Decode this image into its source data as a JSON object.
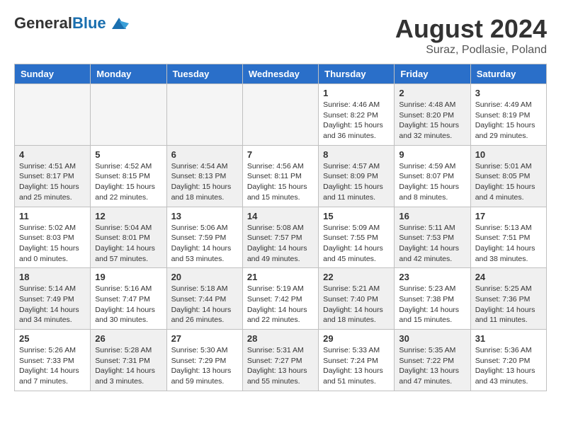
{
  "header": {
    "logo_general": "General",
    "logo_blue": "Blue",
    "month_year": "August 2024",
    "location": "Suraz, Podlasie, Poland"
  },
  "weekdays": [
    "Sunday",
    "Monday",
    "Tuesday",
    "Wednesday",
    "Thursday",
    "Friday",
    "Saturday"
  ],
  "weeks": [
    [
      {
        "day": "",
        "info": "",
        "empty": true
      },
      {
        "day": "",
        "info": "",
        "empty": true
      },
      {
        "day": "",
        "info": "",
        "empty": true
      },
      {
        "day": "",
        "info": "",
        "empty": true
      },
      {
        "day": "1",
        "info": "Sunrise: 4:46 AM\nSunset: 8:22 PM\nDaylight: 15 hours\nand 36 minutes.",
        "shaded": false
      },
      {
        "day": "2",
        "info": "Sunrise: 4:48 AM\nSunset: 8:20 PM\nDaylight: 15 hours\nand 32 minutes.",
        "shaded": true
      },
      {
        "day": "3",
        "info": "Sunrise: 4:49 AM\nSunset: 8:19 PM\nDaylight: 15 hours\nand 29 minutes.",
        "shaded": false
      }
    ],
    [
      {
        "day": "4",
        "info": "Sunrise: 4:51 AM\nSunset: 8:17 PM\nDaylight: 15 hours\nand 25 minutes.",
        "shaded": true
      },
      {
        "day": "5",
        "info": "Sunrise: 4:52 AM\nSunset: 8:15 PM\nDaylight: 15 hours\nand 22 minutes.",
        "shaded": false
      },
      {
        "day": "6",
        "info": "Sunrise: 4:54 AM\nSunset: 8:13 PM\nDaylight: 15 hours\nand 18 minutes.",
        "shaded": true
      },
      {
        "day": "7",
        "info": "Sunrise: 4:56 AM\nSunset: 8:11 PM\nDaylight: 15 hours\nand 15 minutes.",
        "shaded": false
      },
      {
        "day": "8",
        "info": "Sunrise: 4:57 AM\nSunset: 8:09 PM\nDaylight: 15 hours\nand 11 minutes.",
        "shaded": true
      },
      {
        "day": "9",
        "info": "Sunrise: 4:59 AM\nSunset: 8:07 PM\nDaylight: 15 hours\nand 8 minutes.",
        "shaded": false
      },
      {
        "day": "10",
        "info": "Sunrise: 5:01 AM\nSunset: 8:05 PM\nDaylight: 15 hours\nand 4 minutes.",
        "shaded": true
      }
    ],
    [
      {
        "day": "11",
        "info": "Sunrise: 5:02 AM\nSunset: 8:03 PM\nDaylight: 15 hours\nand 0 minutes.",
        "shaded": false
      },
      {
        "day": "12",
        "info": "Sunrise: 5:04 AM\nSunset: 8:01 PM\nDaylight: 14 hours\nand 57 minutes.",
        "shaded": true
      },
      {
        "day": "13",
        "info": "Sunrise: 5:06 AM\nSunset: 7:59 PM\nDaylight: 14 hours\nand 53 minutes.",
        "shaded": false
      },
      {
        "day": "14",
        "info": "Sunrise: 5:08 AM\nSunset: 7:57 PM\nDaylight: 14 hours\nand 49 minutes.",
        "shaded": true
      },
      {
        "day": "15",
        "info": "Sunrise: 5:09 AM\nSunset: 7:55 PM\nDaylight: 14 hours\nand 45 minutes.",
        "shaded": false
      },
      {
        "day": "16",
        "info": "Sunrise: 5:11 AM\nSunset: 7:53 PM\nDaylight: 14 hours\nand 42 minutes.",
        "shaded": true
      },
      {
        "day": "17",
        "info": "Sunrise: 5:13 AM\nSunset: 7:51 PM\nDaylight: 14 hours\nand 38 minutes.",
        "shaded": false
      }
    ],
    [
      {
        "day": "18",
        "info": "Sunrise: 5:14 AM\nSunset: 7:49 PM\nDaylight: 14 hours\nand 34 minutes.",
        "shaded": true
      },
      {
        "day": "19",
        "info": "Sunrise: 5:16 AM\nSunset: 7:47 PM\nDaylight: 14 hours\nand 30 minutes.",
        "shaded": false
      },
      {
        "day": "20",
        "info": "Sunrise: 5:18 AM\nSunset: 7:44 PM\nDaylight: 14 hours\nand 26 minutes.",
        "shaded": true
      },
      {
        "day": "21",
        "info": "Sunrise: 5:19 AM\nSunset: 7:42 PM\nDaylight: 14 hours\nand 22 minutes.",
        "shaded": false
      },
      {
        "day": "22",
        "info": "Sunrise: 5:21 AM\nSunset: 7:40 PM\nDaylight: 14 hours\nand 18 minutes.",
        "shaded": true
      },
      {
        "day": "23",
        "info": "Sunrise: 5:23 AM\nSunset: 7:38 PM\nDaylight: 14 hours\nand 15 minutes.",
        "shaded": false
      },
      {
        "day": "24",
        "info": "Sunrise: 5:25 AM\nSunset: 7:36 PM\nDaylight: 14 hours\nand 11 minutes.",
        "shaded": true
      }
    ],
    [
      {
        "day": "25",
        "info": "Sunrise: 5:26 AM\nSunset: 7:33 PM\nDaylight: 14 hours\nand 7 minutes.",
        "shaded": false
      },
      {
        "day": "26",
        "info": "Sunrise: 5:28 AM\nSunset: 7:31 PM\nDaylight: 14 hours\nand 3 minutes.",
        "shaded": true
      },
      {
        "day": "27",
        "info": "Sunrise: 5:30 AM\nSunset: 7:29 PM\nDaylight: 13 hours\nand 59 minutes.",
        "shaded": false
      },
      {
        "day": "28",
        "info": "Sunrise: 5:31 AM\nSunset: 7:27 PM\nDaylight: 13 hours\nand 55 minutes.",
        "shaded": true
      },
      {
        "day": "29",
        "info": "Sunrise: 5:33 AM\nSunset: 7:24 PM\nDaylight: 13 hours\nand 51 minutes.",
        "shaded": false
      },
      {
        "day": "30",
        "info": "Sunrise: 5:35 AM\nSunset: 7:22 PM\nDaylight: 13 hours\nand 47 minutes.",
        "shaded": true
      },
      {
        "day": "31",
        "info": "Sunrise: 5:36 AM\nSunset: 7:20 PM\nDaylight: 13 hours\nand 43 minutes.",
        "shaded": false
      }
    ]
  ]
}
